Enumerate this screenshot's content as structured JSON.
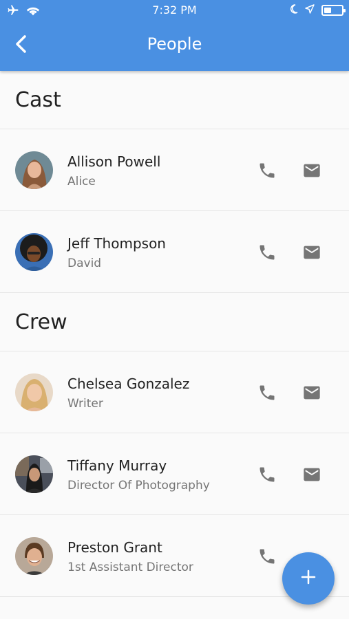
{
  "status_bar": {
    "time": "7:32 PM"
  },
  "app_bar": {
    "title": "People"
  },
  "colors": {
    "accent": "#4a90e2",
    "icon": "#757575"
  },
  "sections": [
    {
      "title": "Cast",
      "people": [
        {
          "name": "Allison Powell",
          "role": "Alice"
        },
        {
          "name": "Jeff Thompson",
          "role": "David"
        }
      ]
    },
    {
      "title": "Crew",
      "people": [
        {
          "name": "Chelsea Gonzalez",
          "role": "Writer"
        },
        {
          "name": "Tiffany Murray",
          "role": "Director Of Photography"
        },
        {
          "name": "Preston Grant",
          "role": "1st Assistant Director"
        }
      ]
    }
  ],
  "fab": {
    "icon": "plus-icon"
  }
}
